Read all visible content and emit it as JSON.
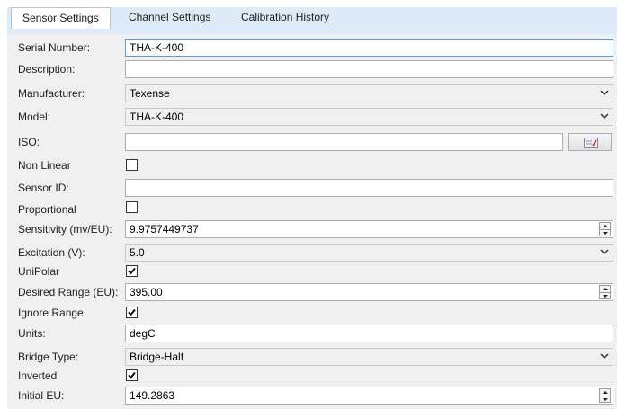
{
  "tabs": {
    "sensor_settings": "Sensor Settings",
    "channel_settings": "Channel Settings",
    "calibration_history": "Calibration History"
  },
  "labels": {
    "serial_number": "Serial Number:",
    "description": "Description:",
    "manufacturer": "Manufacturer:",
    "model": "Model:",
    "iso": "ISO:",
    "non_linear": "Non Linear",
    "sensor_id": "Sensor ID:",
    "proportional": "Proportional",
    "sensitivity": "Sensitivity (mv/EU):",
    "excitation": "Excitation (V):",
    "unipolar": "UniPolar",
    "desired_range": "Desired Range (EU):",
    "ignore_range": "Ignore Range",
    "units": "Units:",
    "bridge_type": "Bridge Type:",
    "inverted": "Inverted",
    "initial_eu": "Initial EU:"
  },
  "values": {
    "serial_number": "THA-K-400",
    "description": "",
    "manufacturer": "Texense",
    "model": "THA-K-400",
    "iso": "",
    "sensor_id": "",
    "sensitivity": "9.9757449737",
    "excitation": "5.0",
    "desired_range": "395.00",
    "units": "degC",
    "bridge_type": "Bridge-Half",
    "initial_eu": "149.2863"
  },
  "checks": {
    "non_linear": false,
    "proportional": false,
    "unipolar": true,
    "ignore_range": true,
    "inverted": true
  },
  "icons": {
    "chevron": "chevron-down-icon",
    "spin": "spin-updown-icon",
    "iso_edit": "edit-list-icon",
    "check": "check-icon"
  },
  "colors": {
    "tab_strip": "#ddeaf7",
    "panel": "#f0f0f0",
    "focus_border": "#569de5",
    "iso_icon_accent": "#d23a3a"
  }
}
